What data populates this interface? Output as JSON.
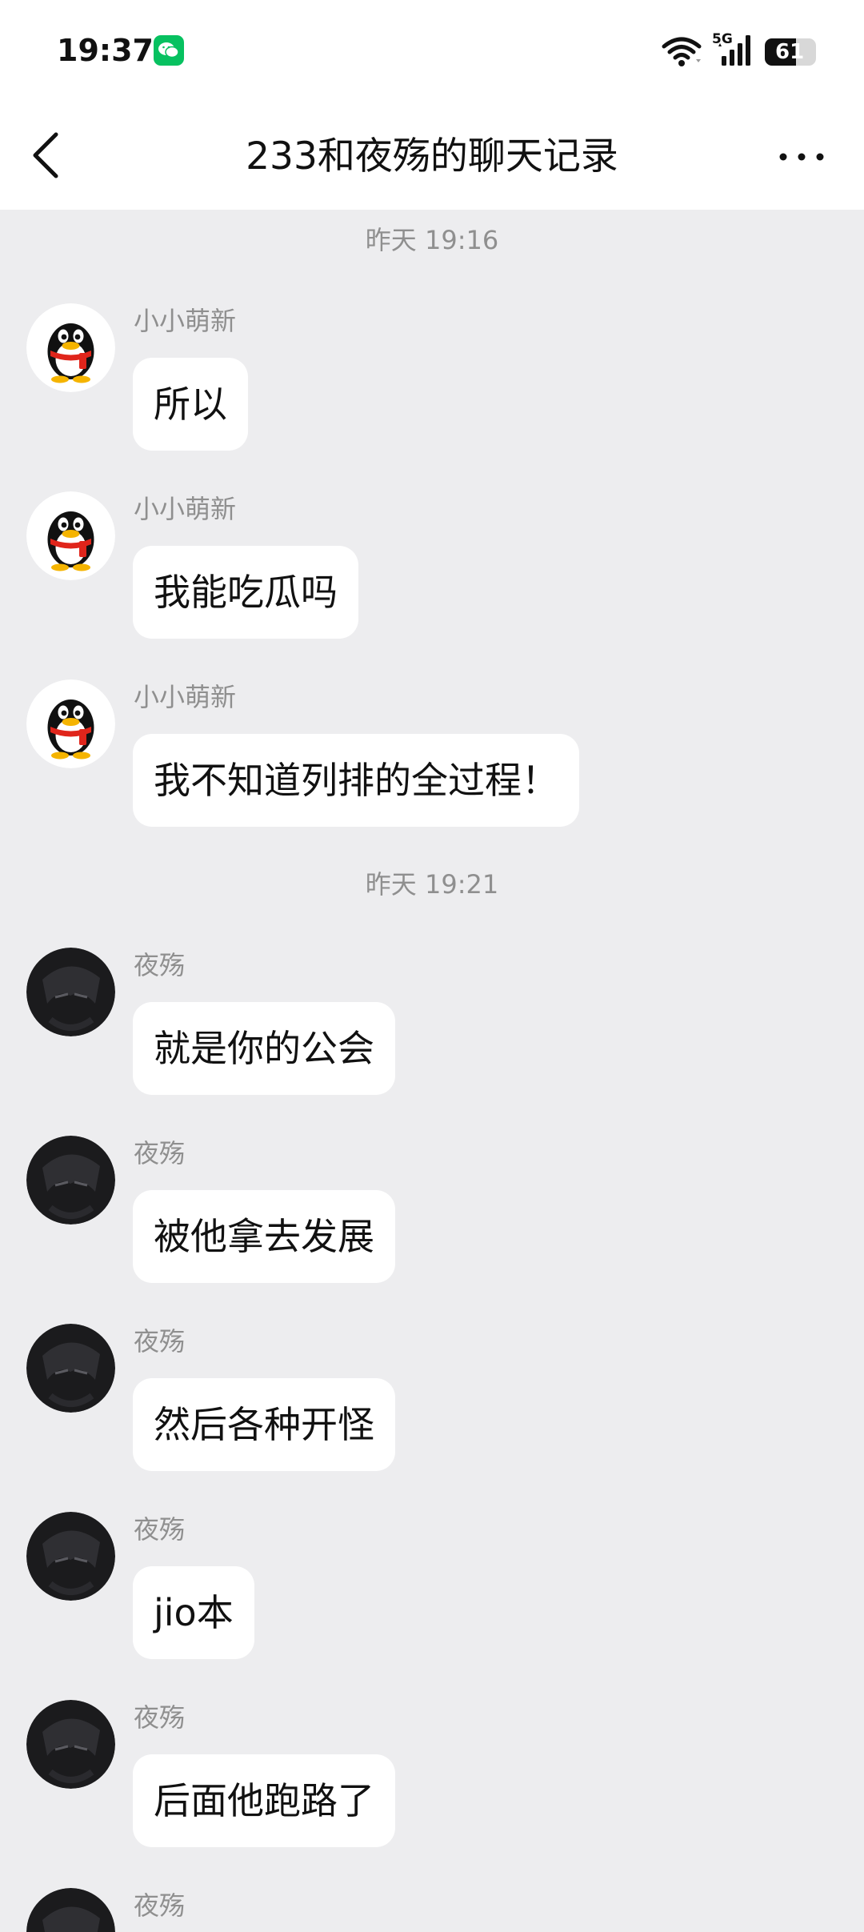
{
  "status_bar": {
    "time": "19:37",
    "network": "5G",
    "battery_percent": "61",
    "battery_level": 0.61,
    "icons": [
      "wechat-notification-icon",
      "wifi-icon",
      "cellular-signal-icon",
      "battery-icon"
    ]
  },
  "nav": {
    "title": "233和夜殇的聊天记录",
    "back_icon": "chevron-left-icon",
    "more_icon": "more-horizontal-icon"
  },
  "colors": {
    "page_bg": "#ededef",
    "bubble_bg": "#ffffff",
    "meta_text": "#8f8f8f",
    "wechat_green": "#07c160",
    "qq_red_scarf": "#e0251b",
    "qq_yellow": "#f5b400"
  },
  "timestamps": [
    "昨天 19:16",
    "昨天 19:21"
  ],
  "messages": [
    {
      "sender": "小小萌新",
      "avatar": "qq-penguin-avatar",
      "text": "所以"
    },
    {
      "sender": "小小萌新",
      "avatar": "qq-penguin-avatar",
      "text": "我能吃瓜吗"
    },
    {
      "sender": "小小萌新",
      "avatar": "qq-penguin-avatar",
      "text": "我不知道列排的全过程！"
    },
    {
      "sender": "夜殇",
      "avatar": "dark-anime-avatar",
      "text": "就是你的公会"
    },
    {
      "sender": "夜殇",
      "avatar": "dark-anime-avatar",
      "text": "被他拿去发展"
    },
    {
      "sender": "夜殇",
      "avatar": "dark-anime-avatar",
      "text": "然后各种开怪"
    },
    {
      "sender": "夜殇",
      "avatar": "dark-anime-avatar",
      "text": "jio本"
    },
    {
      "sender": "夜殇",
      "avatar": "dark-anime-avatar",
      "text": "后面他跑路了"
    },
    {
      "sender": "夜殇",
      "avatar": "dark-anime-avatar",
      "text": ""
    }
  ]
}
